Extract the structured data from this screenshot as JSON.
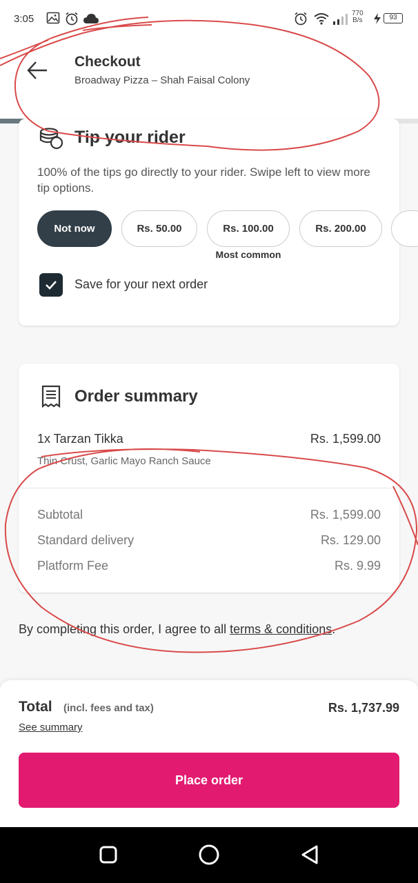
{
  "status_bar": {
    "time": "3:05",
    "net_speed_value": "770",
    "net_speed_unit": "B/s",
    "battery": "93"
  },
  "header": {
    "title": "Checkout",
    "subtitle": "Broadway Pizza – Shah Faisal Colony",
    "progress": 0.83
  },
  "tip": {
    "title": "Tip your rider",
    "description": "100% of the tips go directly to your rider. Swipe left to view more tip options.",
    "options": [
      "Not now",
      "Rs. 50.00",
      "Rs. 100.00",
      "Rs. 200.00"
    ],
    "selected_index": 0,
    "most_common_label": "Most common",
    "save_label": "Save for your next order",
    "save_checked": true
  },
  "order_summary": {
    "title": "Order summary",
    "item": {
      "name": "1x Tarzan Tikka",
      "price": "Rs. 1,599.00",
      "description": "Thin Crust, Garlic Mayo Ranch Sauce"
    },
    "rows": [
      {
        "label": "Subtotal",
        "value": "Rs. 1,599.00"
      },
      {
        "label": "Standard delivery",
        "value": "Rs. 129.00"
      },
      {
        "label": "Platform Fee",
        "value": "Rs. 9.99"
      }
    ]
  },
  "terms": {
    "prefix": "By completing this order, I agree to all ",
    "link": "terms & conditions",
    "suffix": "."
  },
  "footer": {
    "total_label": "Total",
    "total_note": "(incl. fees and tax)",
    "total_value": "Rs. 1,737.99",
    "see_summary": "See summary",
    "place_order": "Place order"
  },
  "colors": {
    "accent": "#e21b70",
    "dark": "#333f48",
    "annotation": "#d94a4a"
  }
}
